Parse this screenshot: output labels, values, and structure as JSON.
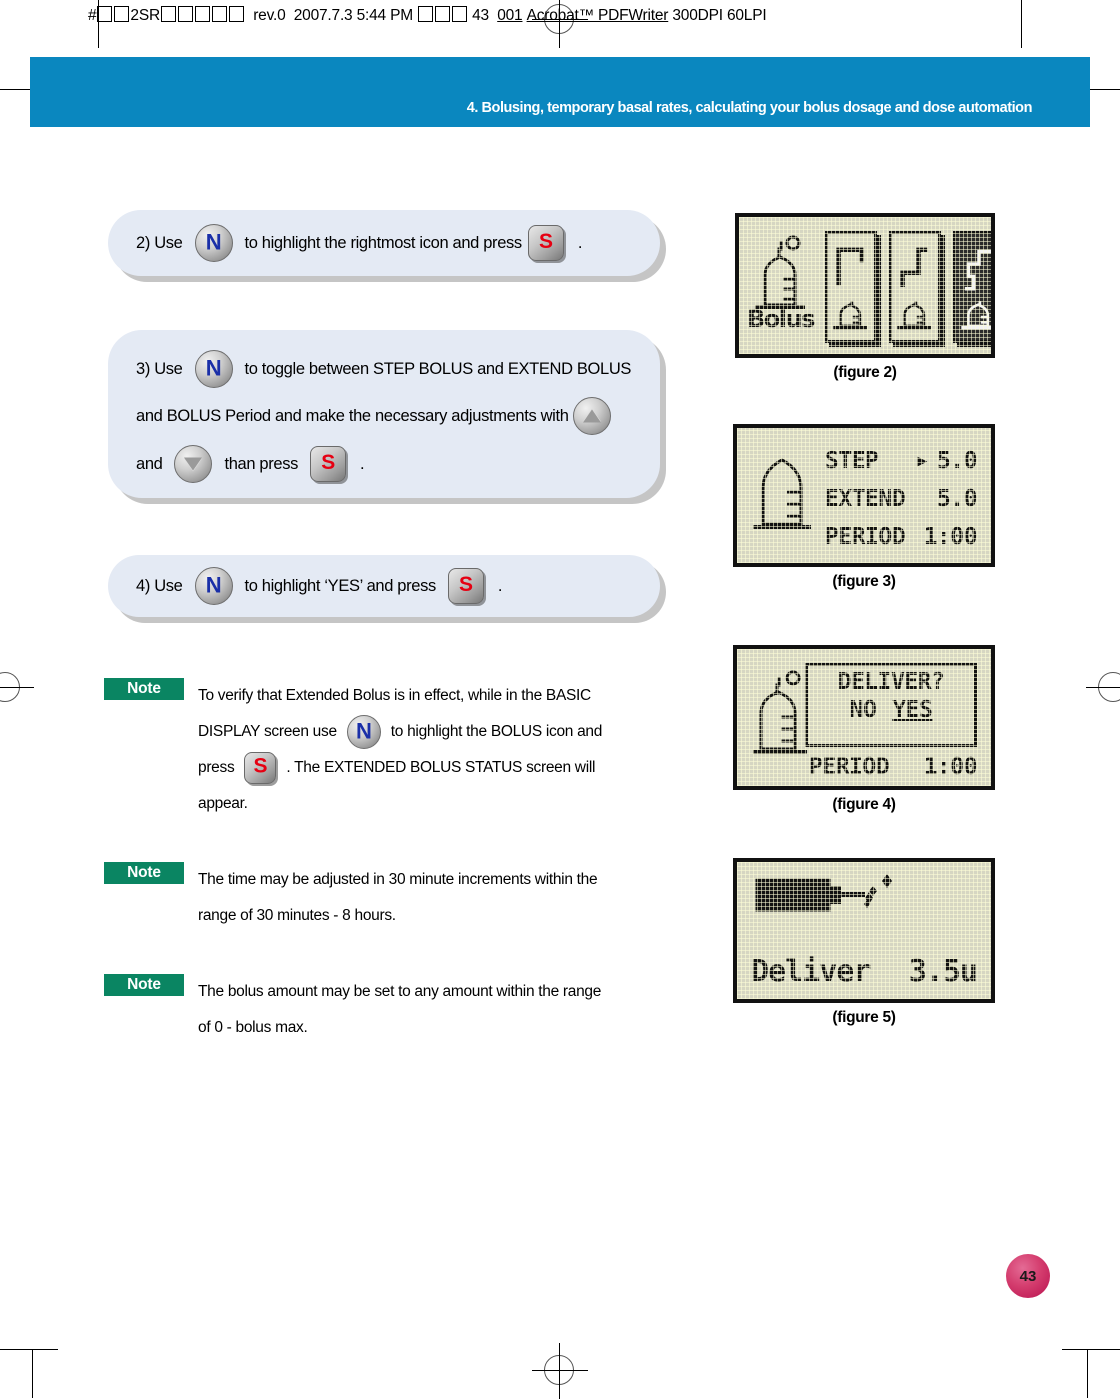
{
  "print_header": {
    "prefix": "#",
    "segment1": "2SR",
    "revision": "rev.0",
    "date": "2007.7.3",
    "time": "5:44 PM",
    "page_marker": "43",
    "job": "001",
    "producer": "Acrobat™ PDFWriter",
    "resolution": "300DPI 60LPI",
    "full_text": "#□□2SR□□□□□ rev.0  2007.7.3 5:44 PM □□□ 43  001 Acrobat™ PDFWriter 300DPI 60LPI"
  },
  "banner": {
    "title": "4. Bolusing, temporary basal rates, calculating your bolus dosage and dose automation",
    "color": "#0a87bf"
  },
  "steps": [
    {
      "id": "step-2",
      "lines": [
        {
          "parts": [
            {
              "type": "text",
              "value": "2) Use"
            },
            {
              "type": "button",
              "value": "N"
            },
            {
              "type": "text",
              "value": "to highlight the rightmost icon and press"
            },
            {
              "type": "button",
              "value": "S"
            },
            {
              "type": "text",
              "value": "."
            }
          ]
        }
      ]
    },
    {
      "id": "step-3",
      "lines": [
        {
          "parts": [
            {
              "type": "text",
              "value": "3) Use"
            },
            {
              "type": "button",
              "value": "N"
            },
            {
              "type": "text",
              "value": "to toggle between STEP BOLUS and EXTEND BOLUS"
            }
          ]
        },
        {
          "parts": [
            {
              "type": "text",
              "value": "and BOLUS Period and make the necessary adjustments with"
            },
            {
              "type": "button",
              "value": "up"
            }
          ]
        },
        {
          "parts": [
            {
              "type": "text",
              "value": "and"
            },
            {
              "type": "button",
              "value": "down"
            },
            {
              "type": "text",
              "value": "than press"
            },
            {
              "type": "button",
              "value": "S"
            },
            {
              "type": "text",
              "value": "."
            }
          ]
        }
      ]
    },
    {
      "id": "step-4",
      "lines": [
        {
          "parts": [
            {
              "type": "text",
              "value": "4) Use"
            },
            {
              "type": "button",
              "value": "N"
            },
            {
              "type": "text",
              "value": "to highlight ‘YES’ and press"
            },
            {
              "type": "button",
              "value": "S"
            },
            {
              "type": "text",
              "value": "."
            }
          ]
        }
      ]
    }
  ],
  "notes": [
    {
      "badge": "Note",
      "lines": [
        {
          "parts": [
            {
              "type": "text",
              "value": "To verify that Extended Bolus is in effect, while in the BASIC"
            }
          ]
        },
        {
          "parts": [
            {
              "type": "text",
              "value": "DISPLAY screen use"
            },
            {
              "type": "button",
              "value": "N"
            },
            {
              "type": "text",
              "value": "to highlight the BOLUS icon and"
            }
          ]
        },
        {
          "parts": [
            {
              "type": "text",
              "value": "press"
            },
            {
              "type": "button",
              "value": "S"
            },
            {
              "type": "text",
              "value": ". The EXTENDED BOLUS STATUS screen will"
            }
          ]
        },
        {
          "parts": [
            {
              "type": "text",
              "value": "appear."
            }
          ]
        }
      ]
    },
    {
      "badge": "Note",
      "lines": [
        {
          "parts": [
            {
              "type": "text",
              "value": "The time may be adjusted in 30 minute increments within the"
            }
          ]
        },
        {
          "parts": [
            {
              "type": "text",
              "value": "range of 30 minutes -  8 hours."
            }
          ]
        }
      ]
    },
    {
      "badge": "Note",
      "lines": [
        {
          "parts": [
            {
              "type": "text",
              "value": "The bolus amount may be set to any amount within the range"
            }
          ]
        },
        {
          "parts": [
            {
              "type": "text",
              "value": "of 0 -  bolus max."
            }
          ]
        }
      ]
    }
  ],
  "figures": {
    "figure2": {
      "caption": "(figure 2)",
      "screen_label": "Bolus",
      "cells": [
        {
          "id": "step-bolus-icon",
          "selected": false
        },
        {
          "id": "extend-bolus-icon",
          "selected": false
        },
        {
          "id": "combo-bolus-icon",
          "selected": true
        }
      ]
    },
    "figure3": {
      "caption": "(figure 3)",
      "rows": [
        {
          "label": "STEP",
          "marker": "▶",
          "value": "5.0"
        },
        {
          "label": "EXTEND",
          "marker": "",
          "value": "5.0"
        },
        {
          "label": "PERIOD",
          "marker": "",
          "value": "1:00"
        }
      ]
    },
    "figure4": {
      "caption": "(figure 4)",
      "ghost_label": "PERIOD",
      "ghost_value": "1:00",
      "prompt": "DELIVER?",
      "option_no": "NO",
      "option_yes": "YES",
      "selected_option": "YES"
    },
    "figure5": {
      "caption": "(figure 5)",
      "label": "Deliver",
      "value": "3.5u"
    }
  },
  "page_number": "43"
}
